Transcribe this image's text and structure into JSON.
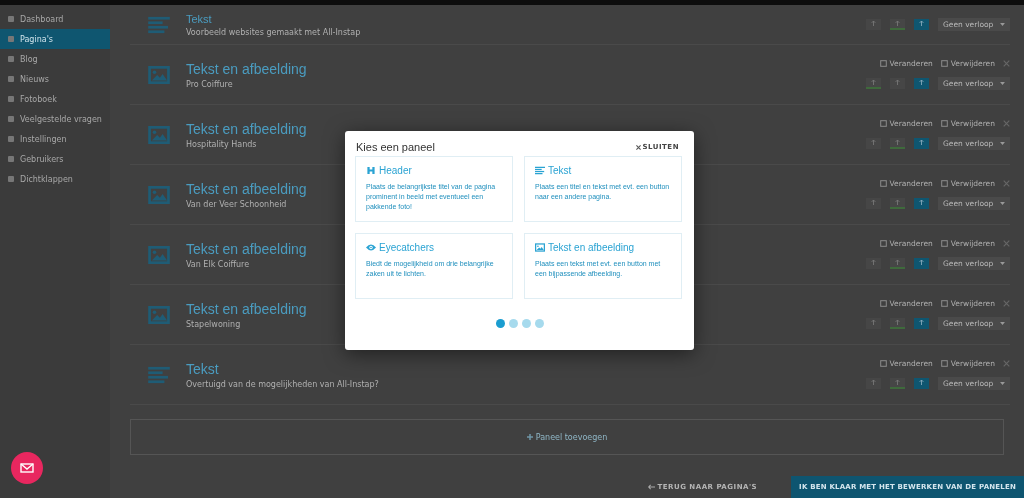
{
  "sidebar": {
    "items": [
      {
        "label": "Dashboard",
        "selected": false
      },
      {
        "label": "Pagina's",
        "selected": true
      },
      {
        "label": "Blog",
        "selected": false
      },
      {
        "label": "Nieuws",
        "selected": false
      },
      {
        "label": "Fotoboek",
        "selected": false
      },
      {
        "label": "Veelgestelde vragen",
        "selected": false
      },
      {
        "label": "Instellingen",
        "selected": false
      },
      {
        "label": "Gebruikers",
        "selected": false
      },
      {
        "label": "Dichtklappen",
        "selected": false
      }
    ]
  },
  "panels": [
    {
      "kind": "text",
      "title": "Tekst",
      "subtitle": "Voorbeeld websites gemaakt met All-Instap",
      "toggles": [
        {
          "selected": false
        },
        {
          "selected": true
        },
        {
          "selected": false
        }
      ],
      "dropdown": "Geen verloop"
    },
    {
      "kind": "image",
      "title": "Tekst en afbeelding",
      "subtitle": "Pro Coiffure",
      "actions": [
        "Veranderen",
        "Verwijderen"
      ],
      "toggles": [
        {
          "selected": true
        },
        {
          "selected": false
        },
        {
          "selected": false
        }
      ],
      "dropdown": "Geen verloop"
    },
    {
      "kind": "image",
      "title": "Tekst en afbeelding",
      "subtitle": "Hospitality Hands",
      "actions": [
        "Veranderen",
        "Verwijderen"
      ],
      "toggles": [
        {
          "selected": false
        },
        {
          "selected": true
        },
        {
          "selected": false
        }
      ],
      "dropdown": "Geen verloop"
    },
    {
      "kind": "image",
      "title": "Tekst en afbeelding",
      "subtitle": "Van der Veer Schoonheid",
      "actions": [
        "Veranderen",
        "Verwijderen"
      ],
      "toggles": [
        {
          "selected": false
        },
        {
          "selected": true
        },
        {
          "selected": false
        }
      ],
      "dropdown": "Geen verloop"
    },
    {
      "kind": "image",
      "title": "Tekst en afbeelding",
      "subtitle": "Van Elk Coiffure",
      "actions": [
        "Veranderen",
        "Verwijderen"
      ],
      "toggles": [
        {
          "selected": false
        },
        {
          "selected": true
        },
        {
          "selected": false
        }
      ],
      "dropdown": "Geen verloop"
    },
    {
      "kind": "image",
      "title": "Tekst en afbeelding",
      "subtitle": "Stapelwoning",
      "actions": [
        "Veranderen",
        "Verwijderen"
      ],
      "toggles": [
        {
          "selected": false
        },
        {
          "selected": true
        },
        {
          "selected": false
        }
      ],
      "dropdown": "Geen verloop"
    },
    {
      "kind": "text",
      "title": "Tekst",
      "subtitle": "Overtuigd van de mogelijkheden van All-Instap?",
      "actions": [
        "Veranderen",
        "Verwijderen"
      ],
      "toggles": [
        {
          "selected": false
        },
        {
          "selected": true
        },
        {
          "selected": false
        }
      ],
      "dropdown": "Geen verloop"
    }
  ],
  "add_panel": "Paneel toevoegen",
  "footer": {
    "back": "TERUG NAAR PAGINA'S",
    "done": "IK BEN KLAAR MET HET BEWERKEN VAN DE PANELEN"
  },
  "modal": {
    "title": "Kies een paneel",
    "close": "SLUITEN",
    "cards": [
      {
        "kind": "header",
        "title": "Header",
        "text": "Plaats de belangrijkste titel van de pagina prominent in beeld met eventueel een pakkende foto!"
      },
      {
        "kind": "text",
        "title": "Tekst",
        "text": "Plaats een titel en tekst met evt. een button naar een andere pagina."
      },
      {
        "kind": "eyecatchers",
        "title": "Eyecatchers",
        "text": "Biedt de mogelijkheid om drie belangrijke zaken uit te lichten."
      },
      {
        "kind": "image",
        "title": "Tekst en afbeelding",
        "text": "Plaats een tekst met evt. een button met een bijpassende afbeelding."
      }
    ],
    "pages": [
      {
        "selected": true
      },
      {
        "selected": false
      },
      {
        "selected": false
      },
      {
        "selected": false
      }
    ]
  }
}
